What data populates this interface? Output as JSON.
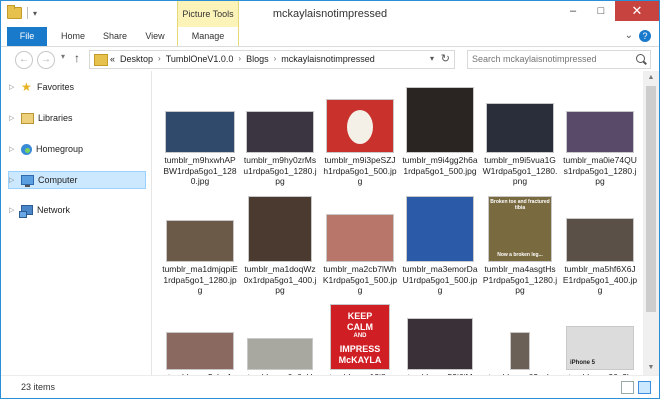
{
  "window": {
    "title": "mckaylaisnotimpressed",
    "context_tab_group": "Picture Tools",
    "minimize": "–",
    "maximize": "□",
    "close": "✕"
  },
  "ribbon": {
    "tabs": [
      "File",
      "Home",
      "Share",
      "View",
      "Manage"
    ],
    "expand": "⌄",
    "help": "?"
  },
  "nav": {
    "back": "←",
    "forward": "→",
    "recent": "▾",
    "up": "↑",
    "breadcrumb_overflow": "«",
    "breadcrumbs": [
      "Desktop",
      "TumblOneV1.0.0",
      "Blogs",
      "mckaylaisnotimpressed"
    ],
    "crumb_sep": "›",
    "address_drop": "▾",
    "refresh": "↻",
    "search_placeholder": "Search mckaylaisnotimpressed"
  },
  "navpane": {
    "expander": "▷",
    "items": [
      {
        "label": "Favorites",
        "icon": "star-icon"
      },
      {
        "label": "Libraries",
        "icon": "library-icon"
      },
      {
        "label": "Homegroup",
        "icon": "homegroup-icon"
      },
      {
        "label": "Computer",
        "icon": "computer-icon",
        "selected": true
      },
      {
        "label": "Network",
        "icon": "network-icon"
      }
    ]
  },
  "files": [
    {
      "name": "tumblr_m9hxwhAPBW1rdpa5go1_1280.jpg",
      "color": "#2f4a6b"
    },
    {
      "name": "tumblr_m9hy0zrMsu1rdpa5go1_1280.jpg",
      "color": "#3a3540"
    },
    {
      "name": "tumblr_m9i3peSZJh1rdpa5go1_500.jpg",
      "color": "#c8312c",
      "accent": "#f4f0e8"
    },
    {
      "name": "tumblr_m9i4gg2h6a1rdpa5go1_500.jpg",
      "color": "#2a2422"
    },
    {
      "name": "tumblr_m9i5vua1GW1rdpa5go1_1280.png",
      "color": "#2a2e3a"
    },
    {
      "name": "tumblr_ma0ie74QUs1rdpa5go1_1280.jpg",
      "color": "#5a4a6a"
    },
    {
      "name": "tumblr_ma1dmjqpiE1rdpa5go1_1280.jpg",
      "color": "#6b5a48"
    },
    {
      "name": "tumblr_ma1doqWz0x1rdpa5go1_400.jpg",
      "color": "#4a3a30"
    },
    {
      "name": "tumblr_ma2cb7lWhK1rdpa5go1_500.jpg",
      "color": "#b8766a"
    },
    {
      "name": "tumblr_ma3emorDaU1rdpa5go1_500.jpg",
      "color": "#2a5aa8"
    },
    {
      "name": "tumblr_ma4asgtHsP1rdpa5go1_1280.jpg",
      "color": "#7a6a40",
      "caption_top": "Broken toe and fractured tibia",
      "caption_bottom": "Now a broken leg..."
    },
    {
      "name": "tumblr_ma5hf6X6JE1rdpa5go1_400.jpg",
      "color": "#5a5048"
    },
    {
      "name": "tumblr_ma5zhqA",
      "color": "#8a6a60"
    },
    {
      "name": "tumblr_ma6u6eH",
      "color": "#a8a8a0"
    },
    {
      "name": "tumblr_ma12i8a",
      "color": "#d01f24",
      "poster": [
        "KEEP",
        "CALM",
        "AND",
        "IMPRESS",
        "McKAYLA"
      ]
    },
    {
      "name": "tumblr_ma59j6jM",
      "color": "#3a3038"
    },
    {
      "name": "tumblr_ma62xob",
      "color": "#6a6058"
    },
    {
      "name": "tumblr_ma90x3h",
      "color": "#dcdcdc",
      "label": "iPhone 5"
    }
  ],
  "status": {
    "item_count": "23 items"
  }
}
